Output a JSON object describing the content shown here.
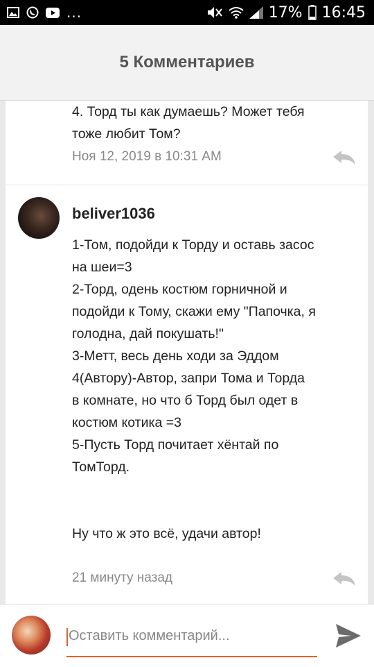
{
  "status_bar": {
    "left_icons": [
      "gallery-icon",
      "whatsapp-icon",
      "youtube-icon"
    ],
    "more": "...",
    "battery": "17%",
    "time": "16:45"
  },
  "header": {
    "title": "5 Комментариев"
  },
  "comments": [
    {
      "text": "4. Торд ты как думаешь? Может тебя\nтоже любит Том?",
      "date": "Ноя 12, 2019 в 10:31 AM"
    },
    {
      "author": "beliver1036",
      "text": "1-Том, подойди к Торду и оставь засос\nна шеи=3\n2-Торд, одень костюм горничной и\nподойди к Тому, скажи ему \"Папочка, я\nголодна, дай покушать!\"\n3-Метт, весь день ходи за Эддом\n4(Автору)-Автор, запри Тома и Торда\nв комнате, но что б Торд был одет в\nкостюм котика =3\n5-Пусть Торд почитает хёнтай по\nТомТорд.\n\n\nНу что ж это всё, удачи автор!",
      "date": "21 минуту назад"
    }
  ],
  "composer": {
    "placeholder": "Оставить комментарий..."
  },
  "colors": {
    "accent": "#e8612c"
  }
}
